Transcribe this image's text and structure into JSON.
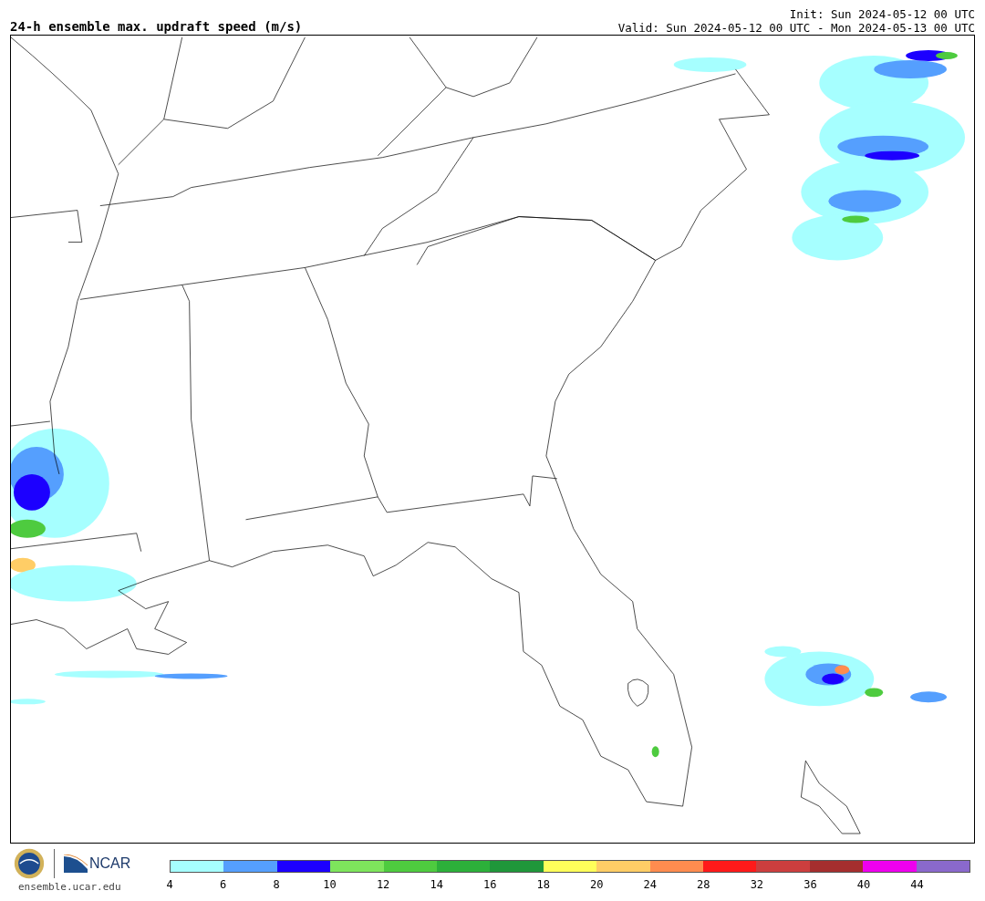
{
  "title": "24-h ensemble max. updraft speed (m/s)",
  "init": "Init: Sun 2024-05-12 00 UTC",
  "valid": "Valid: Sun 2024-05-12 00 UTC - Mon 2024-05-13 00 UTC",
  "footer": {
    "logo_text": "NCAR",
    "website": "ensemble.ucar.edu"
  },
  "colorbar": {
    "bins": [
      {
        "color": "#a6ffff"
      },
      {
        "color": "#559ffe"
      },
      {
        "color": "#1c00ff"
      },
      {
        "color": "#7ee55c"
      },
      {
        "color": "#4ecb3f"
      },
      {
        "color": "#2cb03a"
      },
      {
        "color": "#1f973a"
      },
      {
        "color": "#ffff5a"
      },
      {
        "color": "#ffcd66"
      },
      {
        "color": "#ff8c4f"
      },
      {
        "color": "#ff1a1a"
      },
      {
        "color": "#cc3e3e"
      },
      {
        "color": "#a52e2e"
      },
      {
        "color": "#ee00ee"
      },
      {
        "color": "#8a69cc"
      }
    ],
    "ticks": [
      "4",
      "6",
      "8",
      "10",
      "12",
      "14",
      "16",
      "18",
      "20",
      "24",
      "28",
      "32",
      "36",
      "40",
      "44"
    ]
  }
}
